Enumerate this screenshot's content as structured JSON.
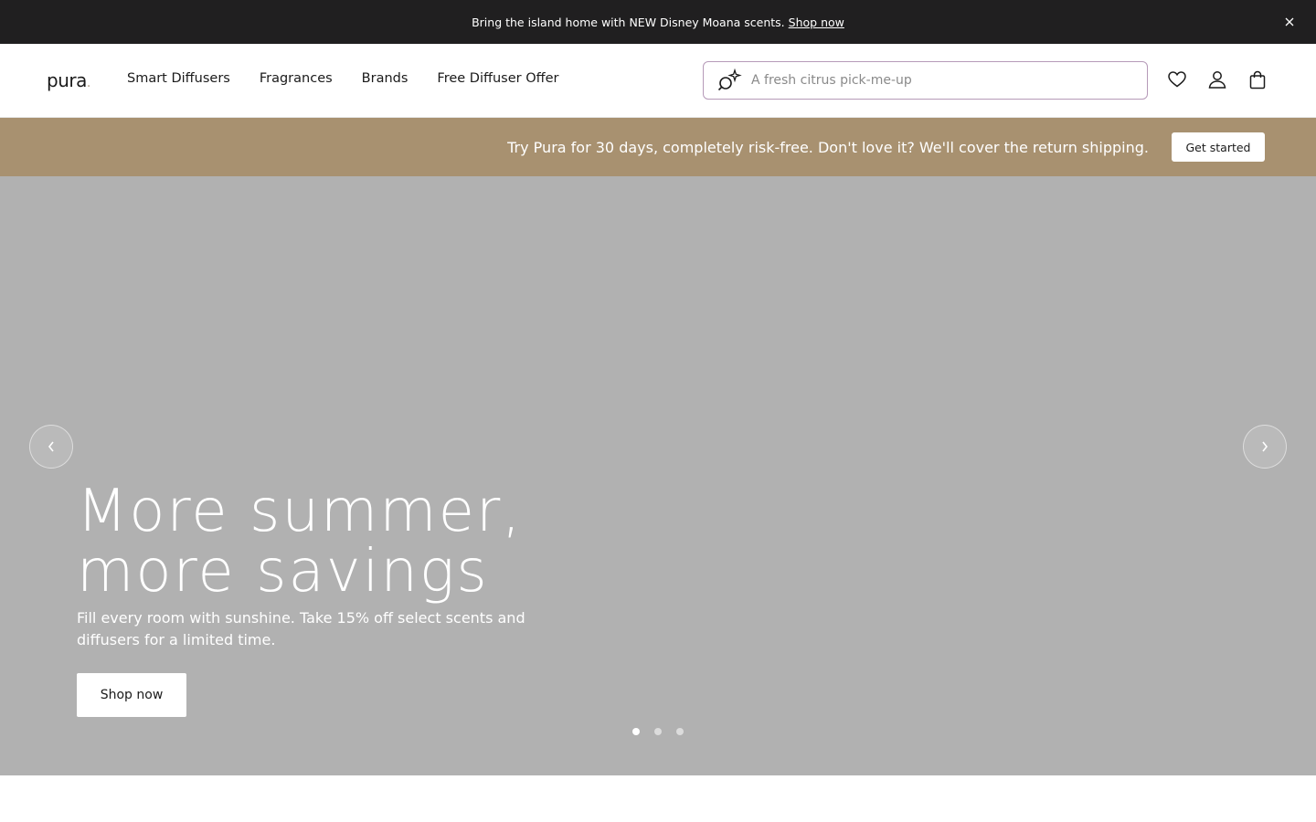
{
  "announcement": {
    "text": "Bring the island home with NEW Disney Moana scents.",
    "link": "Shop now",
    "close_icon": "close-icon"
  },
  "header": {
    "logo": "pura",
    "logo_dot": ".",
    "nav": [
      "Smart Diffusers",
      "Fragrances",
      "Brands",
      "Free Diffuser Offer"
    ],
    "search": {
      "placeholder": "A fresh citrus pick-me-up",
      "icon": "ai-search-icon"
    },
    "icons": [
      "heart-icon",
      "account-icon",
      "bag-icon"
    ]
  },
  "promo": {
    "text": "Try Pura for 30 days, completely risk-free. Don't love it? We'll cover the return shipping.",
    "button": "Get started",
    "color": "#a89170"
  },
  "hero": {
    "title": "More summer,\nmore savings",
    "subtitle": "Fill every room with sunshine. Take 15% off select scents and diffusers for a limited time.",
    "button": "Shop now",
    "slides_total": 3,
    "active_slide": 1,
    "background": "#b1b1b1"
  }
}
